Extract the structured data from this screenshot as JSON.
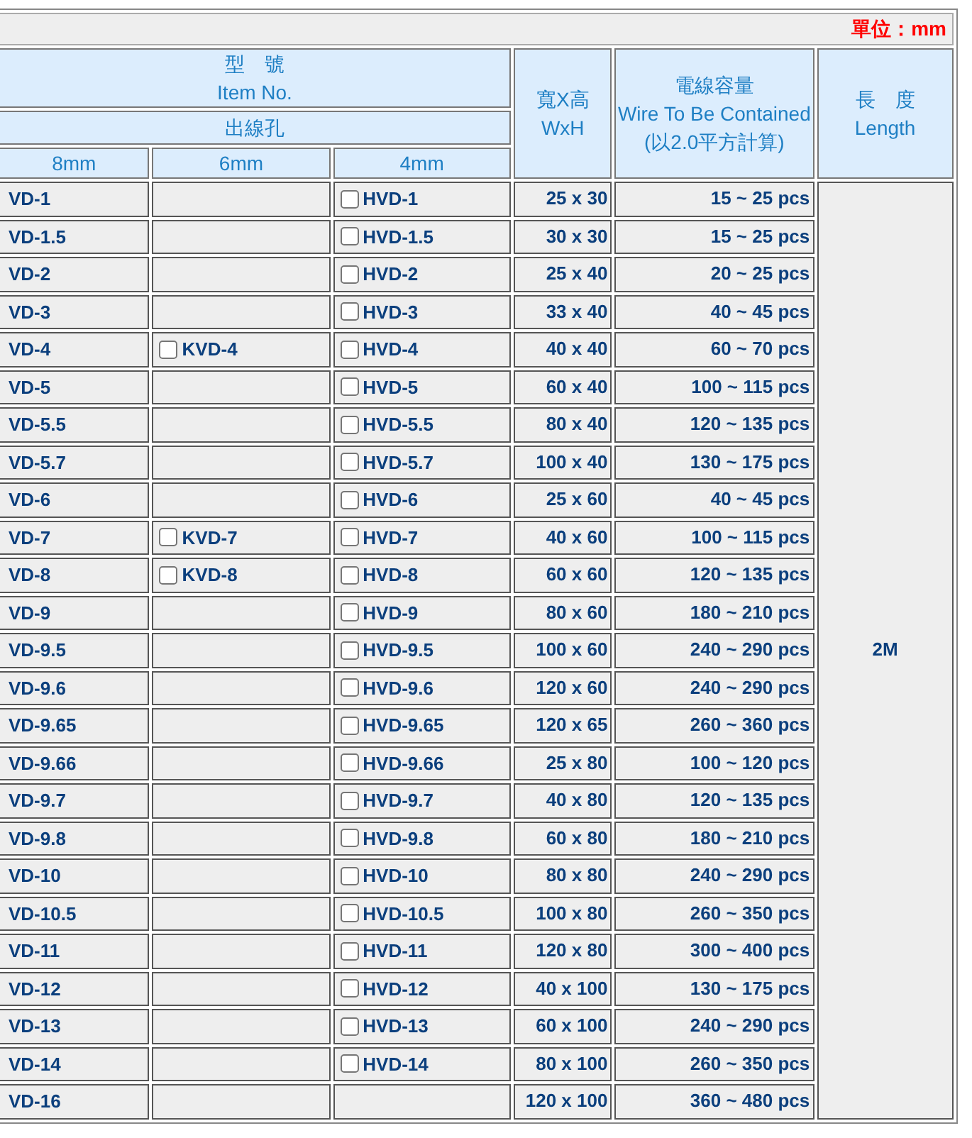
{
  "unit_label": "單位：mm",
  "header": {
    "item_no": [
      "型　號",
      "Item No."
    ],
    "outlet": "出線孔",
    "hole_sizes": [
      "8mm",
      "6mm",
      "4mm"
    ],
    "size": [
      "寬X高",
      "WxH"
    ],
    "capacity": [
      "電線容量",
      "Wire To Be Contained",
      "(以2.0平方計算)"
    ],
    "length": [
      "長　度",
      "Length"
    ]
  },
  "length": "2M",
  "rows": [
    {
      "hole_8mm": {
        "code": "VD-1"
      },
      "hole_4mm": {
        "code": "HVD-1",
        "checked": false
      },
      "size": "25 x 30",
      "capacity": "15 ~ 25 pcs"
    },
    {
      "hole_8mm": {
        "code": "VD-1.5"
      },
      "hole_4mm": {
        "code": "HVD-1.5",
        "checked": false
      },
      "size": "30 x 30",
      "capacity": "15 ~ 25 pcs"
    },
    {
      "hole_8mm": {
        "code": "VD-2"
      },
      "hole_4mm": {
        "code": "HVD-2",
        "checked": false
      },
      "size": "25 x 40",
      "capacity": "20 ~ 25 pcs"
    },
    {
      "hole_8mm": {
        "code": "VD-3"
      },
      "hole_4mm": {
        "code": "HVD-3",
        "checked": false
      },
      "size": "33 x 40",
      "capacity": "40 ~ 45 pcs"
    },
    {
      "hole_8mm": {
        "code": "VD-4"
      },
      "hole_6mm": {
        "code": "KVD-4",
        "checked": false
      },
      "hole_4mm": {
        "code": "HVD-4",
        "checked": false
      },
      "size": "40 x 40",
      "capacity": "60 ~ 70 pcs"
    },
    {
      "hole_8mm": {
        "code": "VD-5"
      },
      "hole_4mm": {
        "code": "HVD-5",
        "checked": false
      },
      "size": "60 x 40",
      "capacity": "100 ~ 115 pcs"
    },
    {
      "hole_8mm": {
        "code": "VD-5.5"
      },
      "hole_4mm": {
        "code": "HVD-5.5",
        "checked": false
      },
      "size": "80 x 40",
      "capacity": "120 ~ 135 pcs"
    },
    {
      "hole_8mm": {
        "code": "VD-5.7"
      },
      "hole_4mm": {
        "code": "HVD-5.7",
        "checked": false
      },
      "size": "100 x 40",
      "capacity": "130 ~ 175 pcs"
    },
    {
      "hole_8mm": {
        "code": "VD-6"
      },
      "hole_4mm": {
        "code": "HVD-6",
        "checked": false
      },
      "size": "25 x 60",
      "capacity": "40 ~ 45 pcs"
    },
    {
      "hole_8mm": {
        "code": "VD-7"
      },
      "hole_6mm": {
        "code": "KVD-7",
        "checked": false
      },
      "hole_4mm": {
        "code": "HVD-7",
        "checked": false
      },
      "size": "40 x 60",
      "capacity": "100 ~ 115 pcs"
    },
    {
      "hole_8mm": {
        "code": "VD-8"
      },
      "hole_6mm": {
        "code": "KVD-8",
        "checked": false
      },
      "hole_4mm": {
        "code": "HVD-8",
        "checked": false
      },
      "size": "60 x 60",
      "capacity": "120 ~ 135 pcs"
    },
    {
      "hole_8mm": {
        "code": "VD-9"
      },
      "hole_4mm": {
        "code": "HVD-9",
        "checked": false
      },
      "size": "80 x 60",
      "capacity": "180 ~ 210 pcs"
    },
    {
      "hole_8mm": {
        "code": "VD-9.5"
      },
      "hole_4mm": {
        "code": "HVD-9.5",
        "checked": false
      },
      "size": "100 x 60",
      "capacity": "240 ~ 290 pcs"
    },
    {
      "hole_8mm": {
        "code": "VD-9.6"
      },
      "hole_4mm": {
        "code": "HVD-9.6",
        "checked": false
      },
      "size": "120 x 60",
      "capacity": "240 ~ 290 pcs"
    },
    {
      "hole_8mm": {
        "code": "VD-9.65"
      },
      "hole_4mm": {
        "code": "HVD-9.65",
        "checked": false
      },
      "size": "120 x 65",
      "capacity": "260 ~ 360 pcs"
    },
    {
      "hole_8mm": {
        "code": "VD-9.66"
      },
      "hole_4mm": {
        "code": "HVD-9.66",
        "checked": false
      },
      "size": "25 x 80",
      "capacity": "100 ~ 120 pcs"
    },
    {
      "hole_8mm": {
        "code": "VD-9.7"
      },
      "hole_4mm": {
        "code": "HVD-9.7",
        "checked": false
      },
      "size": "40 x 80",
      "capacity": "120 ~ 135 pcs"
    },
    {
      "hole_8mm": {
        "code": "VD-9.8"
      },
      "hole_4mm": {
        "code": "HVD-9.8",
        "checked": false
      },
      "size": "60 x 80",
      "capacity": "180 ~ 210 pcs"
    },
    {
      "hole_8mm": {
        "code": "VD-10"
      },
      "hole_4mm": {
        "code": "HVD-10",
        "checked": false
      },
      "size": "80 x 80",
      "capacity": "240 ~ 290 pcs"
    },
    {
      "hole_8mm": {
        "code": "VD-10.5"
      },
      "hole_4mm": {
        "code": "HVD-10.5",
        "checked": false
      },
      "size": "100 x 80",
      "capacity": "260 ~ 350 pcs"
    },
    {
      "hole_8mm": {
        "code": "VD-11"
      },
      "hole_4mm": {
        "code": "HVD-11",
        "checked": false
      },
      "size": "120 x 80",
      "capacity": "300 ~ 400 pcs"
    },
    {
      "hole_8mm": {
        "code": "VD-12"
      },
      "hole_4mm": {
        "code": "HVD-12",
        "checked": false
      },
      "size": "40 x 100",
      "capacity": "130 ~ 175 pcs"
    },
    {
      "hole_8mm": {
        "code": "VD-13"
      },
      "hole_4mm": {
        "code": "HVD-13",
        "checked": false
      },
      "size": "60 x 100",
      "capacity": "240 ~ 290 pcs"
    },
    {
      "hole_8mm": {
        "code": "VD-14"
      },
      "hole_4mm": {
        "code": "HVD-14",
        "checked": false
      },
      "size": "80 x 100",
      "capacity": "260 ~ 350 pcs"
    },
    {
      "hole_8mm": {
        "code": "VD-16"
      },
      "size": "120 x 100",
      "capacity": "360 ~ 480 pcs"
    }
  ]
}
